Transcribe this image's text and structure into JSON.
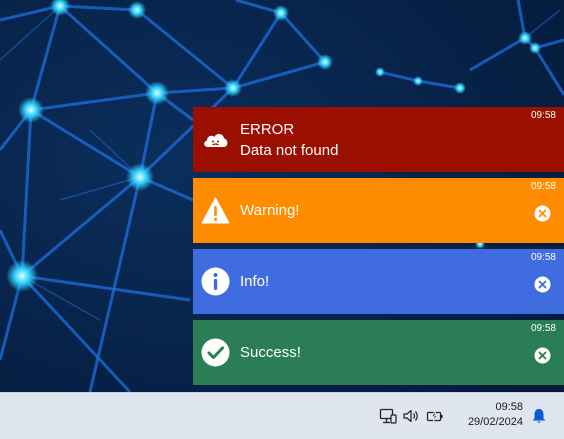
{
  "accent": "#0a58d6",
  "toasts": [
    {
      "type": "error",
      "icon": "cloud-error-icon",
      "color": "#9b0f00",
      "title": "ERROR",
      "message": "Data not found",
      "time": "09:58",
      "closable": false
    },
    {
      "type": "warning",
      "icon": "warning-icon",
      "color": "#ff8c00",
      "message": "Warning!",
      "time": "09:58",
      "closable": true
    },
    {
      "type": "info",
      "icon": "info-icon",
      "color": "#3f6de0",
      "message": "Info!",
      "time": "09:58",
      "closable": true
    },
    {
      "type": "success",
      "icon": "checkmark-icon",
      "color": "#2a7d55",
      "message": "Success!",
      "time": "09:58",
      "closable": true
    }
  ],
  "taskbar": {
    "tray_icons": [
      "network-icon",
      "volume-icon",
      "battery-icon"
    ],
    "clock": {
      "time": "09:58",
      "date": "29/02/2024"
    },
    "notification_icon": "bell-icon"
  }
}
